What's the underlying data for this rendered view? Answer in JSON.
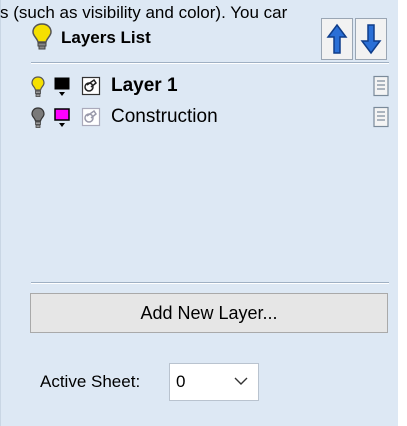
{
  "background_text": "s (such as visibility and color). You car",
  "panel": {
    "title": "Layers List",
    "move_up_icon": "arrow-up-icon",
    "move_down_icon": "arrow-down-icon",
    "layers": [
      {
        "name": "Layer 1",
        "visible": true,
        "color": "#000000",
        "bold": true
      },
      {
        "name": "Construction",
        "visible": false,
        "color": "#ff00ff",
        "bold": false
      }
    ],
    "add_button_label": "Add New Layer...",
    "active_sheet_label": "Active Sheet:",
    "active_sheet_value": "0"
  },
  "colors": {
    "panel_bg": "#dde8f4",
    "bulb_on": "#f5e000",
    "arrow_blue": "#2a6fd6"
  }
}
